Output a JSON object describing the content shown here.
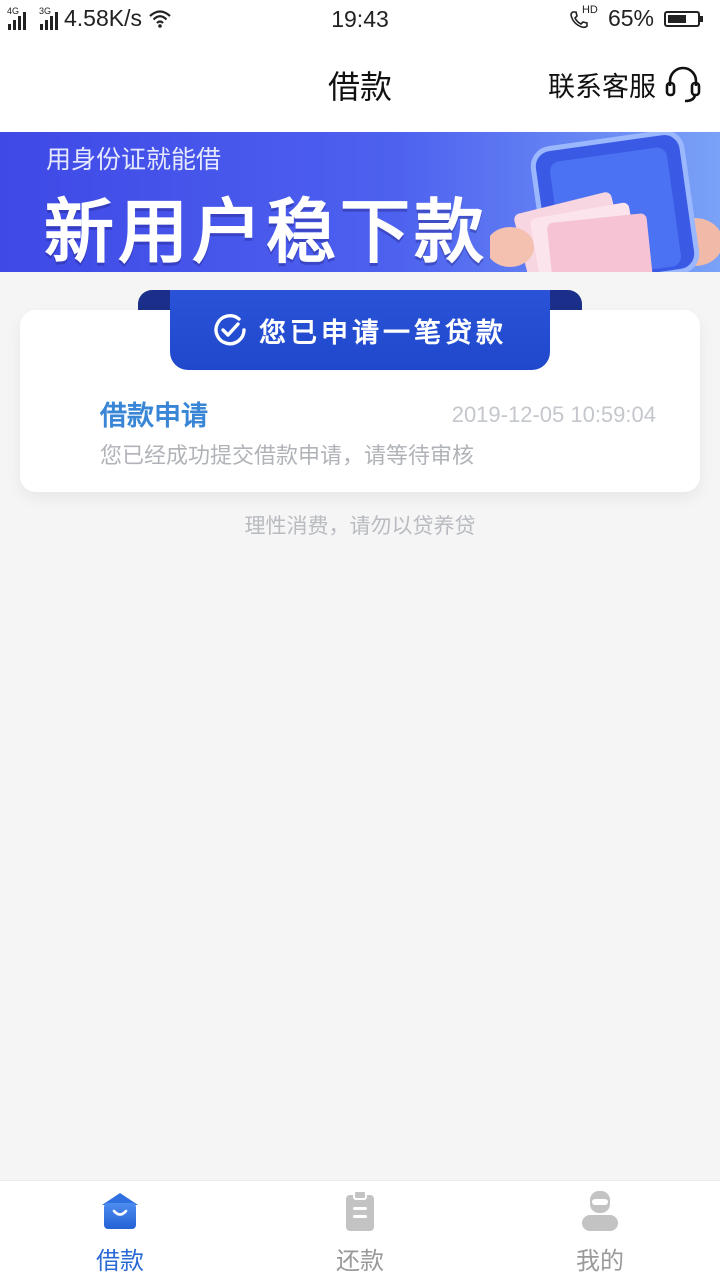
{
  "status_bar": {
    "network_1": "4G",
    "network_2": "3G",
    "speed": "4.58K/s",
    "time": "19:43",
    "hd": "HD",
    "battery": "65%",
    "battery_level": 0.65
  },
  "header": {
    "title": "借款",
    "customer_service": "联系客服",
    "customer_service_icon": "headset-icon"
  },
  "banner": {
    "subtitle": "用身份证就能借",
    "headline": "新用户稳下款"
  },
  "card": {
    "ribbon_text": "您已申请一笔贷款",
    "ribbon_icon": "check-circle-icon",
    "item_title": "借款申请",
    "item_time": "2019-12-05 10:59:04",
    "item_desc": "您已经成功提交借款申请，请等待审核"
  },
  "tip": "理性消费，请勿以贷养贷",
  "tabbar": {
    "tabs": [
      {
        "label": "借款",
        "icon": "bag-icon",
        "active": true
      },
      {
        "label": "还款",
        "icon": "clipboard-icon",
        "active": false
      },
      {
        "label": "我的",
        "icon": "user-icon",
        "active": false
      }
    ]
  },
  "colors": {
    "accent": "#2b69d6",
    "banner_start": "#3f49e6",
    "ribbon": "#1f48cc"
  }
}
